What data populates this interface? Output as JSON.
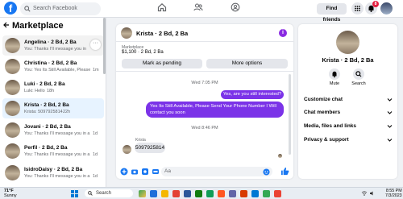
{
  "header": {
    "logo": "f",
    "search_placeholder": "Search Facebook",
    "find_friends": "Find friends",
    "notif_count": "8",
    "icons": [
      "home-icon",
      "friends-icon",
      "groups-icon",
      "apps-grid-icon",
      "messenger-icon",
      "bell-icon",
      "profile-avatar"
    ]
  },
  "sidebar": {
    "title": "Marketplace",
    "conversations": [
      {
        "name": "Angelina · 2 Bd, 2 Ba",
        "preview": "You: Thanks I'll message you in a...",
        "time": ""
      },
      {
        "name": "Christina · 2 Bd, 2 Ba",
        "preview": "You: Yes Its Still Available, Please S...",
        "time": "1m"
      },
      {
        "name": "Luki · 2 Bd, 2 Ba",
        "preview": "Luki: Hello",
        "time": "18h"
      },
      {
        "name": "Krista · 2 Bd, 2 Ba",
        "preview": "Krista: 5097925814",
        "time": "22h"
      },
      {
        "name": "Jovani · 2 Bd, 2 Ba",
        "preview": "You: Thanks I'll message you in a...",
        "time": "1d"
      },
      {
        "name": "Perfil · 2 Bd, 2 Ba",
        "preview": "You: Thanks I'll message you in a...",
        "time": "1d"
      },
      {
        "name": "IsidroDaisy · 2 Bd, 2 Ba",
        "preview": "You: Thanks I'll message you in a...",
        "time": "1d"
      }
    ]
  },
  "chat": {
    "title": "Krista · 2 Bd, 2 Ba",
    "listing_label": "Marketplace",
    "listing_price": "$1,100 · 2 Bd, 2 Ba",
    "mark_pending": "Mark as pending",
    "more_options": "More options",
    "time1": "Wed 7:05 PM",
    "out_msg1": "Yes, are you still interested?",
    "out_msg2_line1": "Yes Its Still Available, Please Send Your Phone Number I Will",
    "out_msg2_line2": "contact you soon",
    "time2": "Wed 8:46 PM",
    "sender": "Krista",
    "in_msg": "5097925814",
    "input_placeholder": "Aa"
  },
  "details": {
    "name": "Krista · 2 Bd, 2 Ba",
    "mute": "Mute",
    "search": "Search",
    "sections": [
      "Customize chat",
      "Chat members",
      "Media, files and links",
      "Privacy & support"
    ]
  },
  "taskbar": {
    "temp": "71°F",
    "weather": "Sunny",
    "search": "Search",
    "time": "8:55 PM",
    "date": "7/3/2023"
  },
  "colors": {
    "brand": "#1877f2",
    "accent": "#7b33e8",
    "badge": "#e41e3f"
  }
}
